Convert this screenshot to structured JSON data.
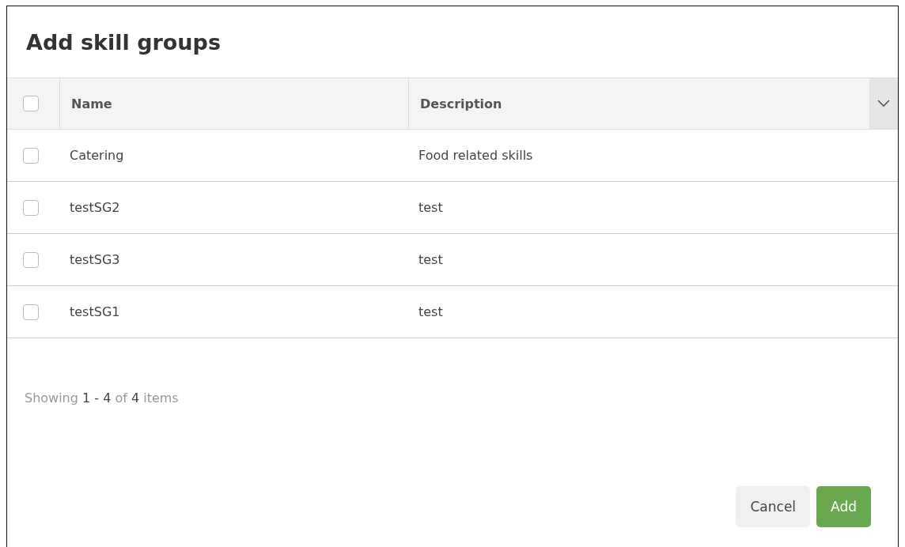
{
  "dialog": {
    "title": "Add skill groups"
  },
  "table": {
    "select_all": {
      "checked": false
    },
    "columns": [
      "Name",
      "Description"
    ],
    "rows": [
      {
        "name": "Catering",
        "description": "Food related skills",
        "checked": false
      },
      {
        "name": "testSG2",
        "description": "test",
        "checked": false
      },
      {
        "name": "testSG3",
        "description": "test",
        "checked": false
      },
      {
        "name": "testSG1",
        "description": "test",
        "checked": false
      }
    ]
  },
  "pager": {
    "prefix": "Showing",
    "range": "1 - 4",
    "middle": "of",
    "total": "4",
    "suffix": "items"
  },
  "buttons": [
    {
      "label": "Cancel",
      "kind": "secondary"
    },
    {
      "label": "Add",
      "kind": "primary"
    }
  ]
}
